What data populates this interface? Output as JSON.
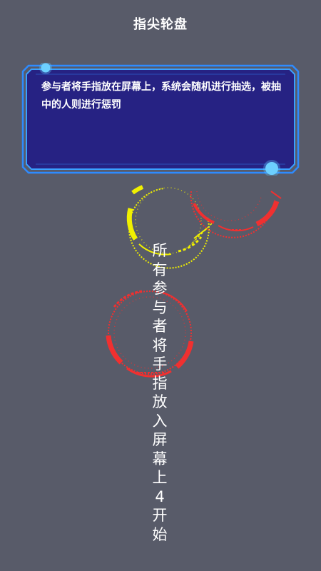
{
  "header": {
    "title": "指尖轮盘"
  },
  "rules_panel": {
    "text": "参与者将手指放在屏幕上，系统会随机进行抽选，被抽中的人则进行惩罚"
  },
  "instruction": {
    "text": "所有参与者将手指放入屏幕上4开始"
  },
  "colors": {
    "background": "#585b69",
    "panel_fill": "#262283",
    "panel_border": "#2e8bff",
    "accent_glow": "#5ec6ff",
    "ring_yellow": "#f0f000",
    "ring_red": "#f03030"
  },
  "icons": [
    "finger-ring-yellow",
    "finger-ring-red",
    "finger-ring-red"
  ]
}
